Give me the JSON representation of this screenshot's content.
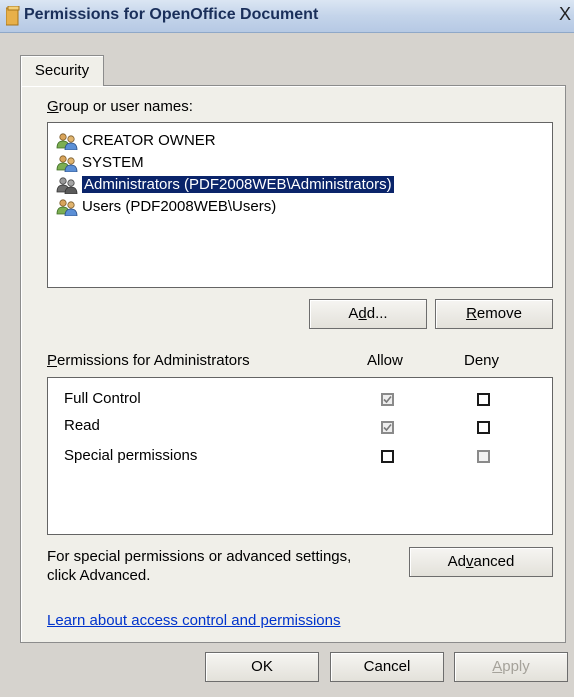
{
  "window": {
    "title": "Permissions for OpenOffice Document",
    "close_symbol": "X"
  },
  "tabs": [
    {
      "label": "Security"
    }
  ],
  "group_label": "Group or user names:",
  "users": [
    {
      "name": "CREATOR OWNER",
      "icon": "users-icon"
    },
    {
      "name": "SYSTEM",
      "icon": "users-icon"
    },
    {
      "name": "Administrators (PDF2008WEB\\Administrators)",
      "icon": "users-icon",
      "selected": true
    },
    {
      "name": "Users (PDF2008WEB\\Users)",
      "icon": "users-icon"
    }
  ],
  "buttons": {
    "add": "Add...",
    "remove": "Remove",
    "advanced": "Advanced",
    "ok": "OK",
    "cancel": "Cancel",
    "apply": "Apply"
  },
  "permissions": {
    "label": "Permissions for Administrators",
    "allow_header": "Allow",
    "deny_header": "Deny",
    "rows": [
      {
        "name": "Full Control",
        "allow": true,
        "deny": false
      },
      {
        "name": "Read",
        "allow": true,
        "deny": false
      },
      {
        "name": "Special permissions",
        "allow": false,
        "deny": false
      }
    ]
  },
  "advanced_text": "For special permissions or advanced settings, click Advanced.",
  "advanced_text_line1": "For special permissions or advanced settings,",
  "advanced_text_line2": "click Advanced.",
  "link": "Learn about access control and permissions"
}
